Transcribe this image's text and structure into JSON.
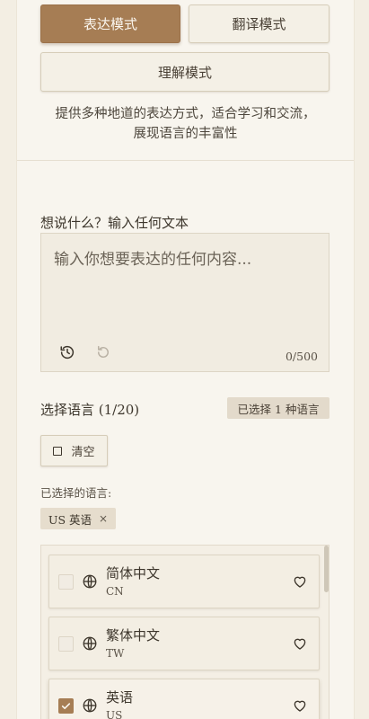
{
  "modes": {
    "expression": "表达模式",
    "translation": "翻译模式",
    "understanding": "理解模式"
  },
  "description": {
    "line1": "提供多种地道的表达方式，适合学习和交流，",
    "line2": "展现语言的丰富性"
  },
  "input": {
    "label": "想说什么？输入任何文本",
    "placeholder": "输入你想要表达的任何内容...",
    "counter": "0/500",
    "history_icon": "history-icon",
    "undo_icon": "undo-icon"
  },
  "language": {
    "label": "选择语言 (1/20)",
    "selected_badge": "已选择 1 种语言",
    "clear_label": "清空",
    "selected_label": "已选择的语言:",
    "chips": [
      {
        "label": "US 英语",
        "remove": "×"
      }
    ],
    "items": [
      {
        "name": "简体中文",
        "code": "CN",
        "checked": false
      },
      {
        "name": "繁体中文",
        "code": "TW",
        "checked": false
      },
      {
        "name": "英语",
        "code": "US",
        "checked": true
      }
    ]
  },
  "colors": {
    "accent": "#a67d54",
    "background": "#f8f5ee"
  }
}
